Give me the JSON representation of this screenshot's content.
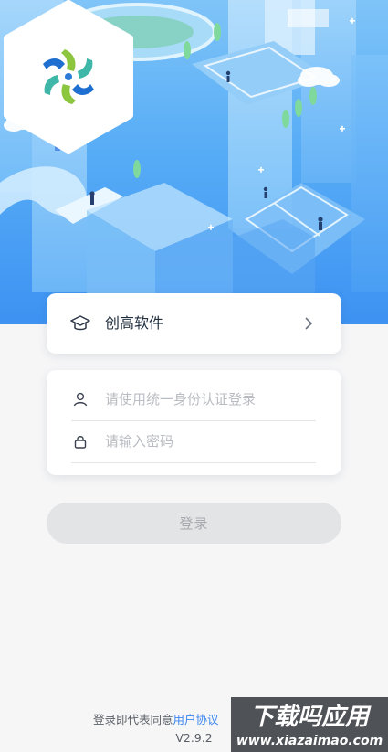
{
  "school": {
    "name": "创高软件"
  },
  "login_form": {
    "username_placeholder": "请使用统一身份认证登录",
    "password_placeholder": "请输入密码",
    "submit_label": "登录"
  },
  "footer": {
    "agreement_prefix": "登录即代表同意",
    "agreement_link": "用户协议",
    "version": "V2.9.2"
  },
  "watermark": {
    "title": "下载吗应用",
    "url": "www.xiazaimao.com"
  },
  "icons": {
    "school": "graduation-cap-icon",
    "chevron": "chevron-right-icon",
    "user": "user-icon",
    "lock": "lock-icon"
  },
  "colors": {
    "hero_blue": "#58adf6",
    "link_blue": "#3b86ee",
    "button_disabled": "#e3e4e6",
    "logo_green": "#8cc63f",
    "logo_blue": "#1e6fd0",
    "logo_teal": "#3fb7a8"
  }
}
